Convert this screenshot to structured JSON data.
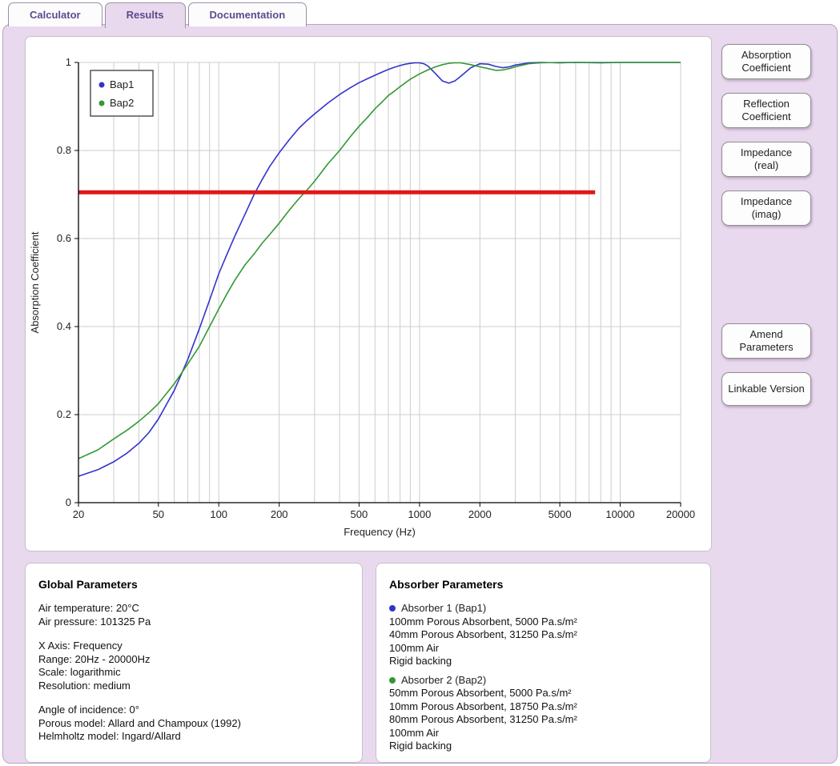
{
  "tabs": [
    {
      "label": "Calculator",
      "active": false
    },
    {
      "label": "Results",
      "active": true
    },
    {
      "label": "Documentation",
      "active": false
    }
  ],
  "side_buttons": [
    "Absorption Coefficient",
    "Reflection Coefficient",
    "Impedance (real)",
    "Impedance (imag)"
  ],
  "action_buttons": [
    "Amend Parameters",
    "Linkable Version"
  ],
  "chart_data": {
    "type": "line",
    "title": "",
    "xlabel": "Frequency (Hz)",
    "ylabel": "Absorption Coefficient",
    "x_scale": "log",
    "xlim": [
      20,
      20000
    ],
    "ylim": [
      0,
      1
    ],
    "x_ticks": [
      20,
      50,
      100,
      200,
      500,
      1000,
      2000,
      5000,
      10000,
      20000
    ],
    "y_ticks": [
      0,
      0.2,
      0.4,
      0.6,
      0.8,
      1
    ],
    "grid": true,
    "legend_position": "top-left",
    "series": [
      {
        "name": "Bap1",
        "color": "#3333cc",
        "x": [
          20,
          25,
          30,
          35,
          40,
          45,
          50,
          60,
          70,
          80,
          90,
          100,
          110,
          120,
          135,
          150,
          165,
          180,
          200,
          225,
          250,
          275,
          300,
          350,
          400,
          450,
          500,
          550,
          600,
          650,
          700,
          750,
          800,
          850,
          900,
          950,
          1000,
          1050,
          1100,
          1200,
          1300,
          1400,
          1500,
          1600,
          1800,
          2000,
          2200,
          2400,
          2600,
          2800,
          3000,
          3500,
          4000,
          5000,
          6000,
          8000,
          10000,
          14000,
          20000
        ],
        "y": [
          0.06,
          0.075,
          0.093,
          0.113,
          0.135,
          0.16,
          0.19,
          0.255,
          0.325,
          0.395,
          0.46,
          0.52,
          0.565,
          0.605,
          0.655,
          0.7,
          0.735,
          0.765,
          0.795,
          0.825,
          0.85,
          0.868,
          0.883,
          0.908,
          0.927,
          0.942,
          0.954,
          0.963,
          0.971,
          0.978,
          0.984,
          0.989,
          0.993,
          0.996,
          0.998,
          0.999,
          0.999,
          0.997,
          0.992,
          0.975,
          0.958,
          0.953,
          0.958,
          0.968,
          0.988,
          0.997,
          0.996,
          0.991,
          0.988,
          0.99,
          0.994,
          0.999,
          1.0,
          0.999,
          1.0,
          0.999,
          1.0,
          1.0,
          1.0
        ]
      },
      {
        "name": "Bap2",
        "color": "#339933",
        "x": [
          20,
          25,
          30,
          35,
          40,
          45,
          50,
          60,
          70,
          80,
          90,
          100,
          110,
          120,
          135,
          150,
          165,
          180,
          200,
          225,
          250,
          275,
          300,
          350,
          400,
          450,
          500,
          550,
          600,
          650,
          700,
          750,
          800,
          900,
          1000,
          1100,
          1200,
          1300,
          1400,
          1500,
          1600,
          1800,
          2000,
          2200,
          2400,
          2600,
          2800,
          3000,
          3500,
          4000,
          5000,
          6000,
          8000,
          10000,
          14000,
          20000
        ],
        "y": [
          0.1,
          0.12,
          0.145,
          0.165,
          0.185,
          0.205,
          0.225,
          0.27,
          0.315,
          0.355,
          0.4,
          0.44,
          0.475,
          0.505,
          0.54,
          0.565,
          0.59,
          0.61,
          0.635,
          0.665,
          0.69,
          0.71,
          0.73,
          0.77,
          0.8,
          0.83,
          0.855,
          0.875,
          0.895,
          0.91,
          0.925,
          0.935,
          0.945,
          0.962,
          0.974,
          0.983,
          0.99,
          0.995,
          0.998,
          0.999,
          0.999,
          0.995,
          0.99,
          0.986,
          0.982,
          0.983,
          0.986,
          0.99,
          0.997,
          0.999,
          1.0,
          1.0,
          1.0,
          1.0,
          1.0,
          1.0
        ]
      }
    ],
    "threshold": {
      "y": 0.705,
      "x_start": 20,
      "x_end": 7500,
      "color": "#e01818",
      "width": 5
    }
  },
  "global_parameters": {
    "title": "Global Parameters",
    "lines": [
      "Air temperature: 20°C",
      "Air pressure: 101325 Pa",
      "",
      "X Axis: Frequency",
      "Range: 20Hz - 20000Hz",
      "Scale: logarithmic",
      "Resolution: medium",
      "",
      "Angle of incidence: 0°",
      "Porous model: Allard and Champoux (1992)",
      "Helmholtz model: Ingard/Allard"
    ]
  },
  "absorber_parameters": {
    "title": "Absorber Parameters",
    "absorbers": [
      {
        "name": "Absorber 1 (Bap1)",
        "color": "#3333cc",
        "layers": [
          "100mm Porous Absorbent, 5000 Pa.s/m²",
          "40mm Porous Absorbent, 31250 Pa.s/m²",
          "100mm Air",
          "Rigid backing"
        ]
      },
      {
        "name": "Absorber 2 (Bap2)",
        "color": "#339933",
        "layers": [
          "50mm Porous Absorbent, 5000 Pa.s/m²",
          "10mm Porous Absorbent, 18750 Pa.s/m²",
          "80mm Porous Absorbent, 31250 Pa.s/m²",
          "100mm Air",
          "Rigid backing"
        ]
      }
    ]
  }
}
